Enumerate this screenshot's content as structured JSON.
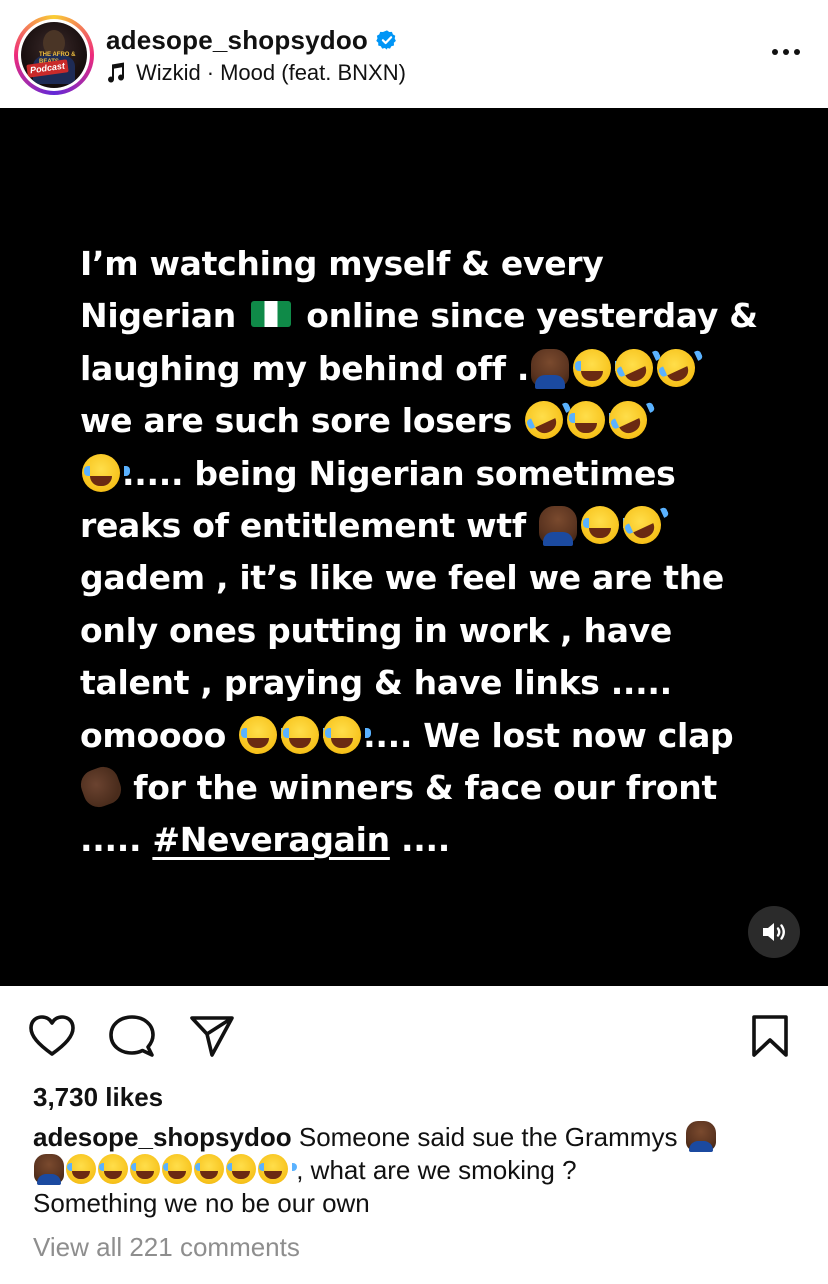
{
  "header": {
    "username": "adesope_shopsydoo",
    "verified": true,
    "avatar_badge_text": "Podcast",
    "avatar_tag_text": "THE AFRO & BEATS",
    "music": {
      "artist": "Wizkid",
      "separator": "·",
      "title": "Mood (feat. BNXN)"
    }
  },
  "post_image": {
    "background": "#000000",
    "text_color": "#ffffff",
    "lines": [
      [
        "I’m watching myself & every"
      ],
      [
        "Nigerian ",
        "[flag-ng]",
        " online since yesterday &"
      ],
      [
        "laughing my behind off .",
        "[facepalm]",
        "[joy]",
        "[rofl]",
        "[rofl]"
      ],
      [
        "we are such sore losers ",
        "[rofl]",
        "[joy]",
        "[rofl]"
      ],
      [
        "[joy]",
        "..... being Nigerian sometimes"
      ],
      [
        "reaks of entitlement  wtf ",
        "[facepalm]",
        "[joy]",
        "[rofl]"
      ],
      [
        "gadem , it’s like we feel we are the"
      ],
      [
        "only ones putting in work , have"
      ],
      [
        "talent , praying & have links ....."
      ],
      [
        "omoooo ",
        "[joy]",
        "[joy]",
        "[joy]",
        ".... We lost now clap"
      ],
      [
        "[clap]",
        " for the winners & face our front"
      ],
      [
        "..... ",
        "#Neveragain",
        " ...."
      ]
    ],
    "hashtag": "#Neveragain"
  },
  "actions": {
    "like_icon": "heart-icon",
    "comment_icon": "comment-icon",
    "share_icon": "send-icon",
    "save_icon": "bookmark-icon",
    "sound_icon": "speaker-icon"
  },
  "likes_text": "3,730 likes",
  "caption": {
    "username": "adesope_shopsydoo",
    "text_part1": " Someone said sue the Grammys ",
    "text_part2": " , what are we smoking ?",
    "text_part3": "Something we no be our own"
  },
  "view_comments_text": "View all 221 comments",
  "colors": {
    "verified_blue": "#0095f6",
    "muted_text": "#8e8e8e"
  }
}
